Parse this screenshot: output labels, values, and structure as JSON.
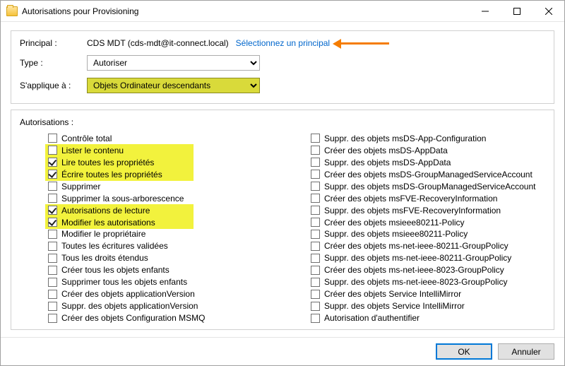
{
  "window": {
    "title": "Autorisations pour Provisioning"
  },
  "header": {
    "principal_label": "Principal :",
    "principal_value": "CDS MDT (cds-mdt@it-connect.local)",
    "select_principal_link": "Sélectionnez un principal",
    "type_label": "Type :",
    "type_value": "Autoriser",
    "applies_label": "S'applique à :",
    "applies_value": "Objets Ordinateur descendants"
  },
  "autz_label": "Autorisations :",
  "perms_left": [
    {
      "label": "Contrôle total",
      "checked": false,
      "hl": false
    },
    {
      "label": "Lister le contenu",
      "checked": false,
      "hl": true
    },
    {
      "label": "Lire toutes les propriétés",
      "checked": true,
      "hl": true
    },
    {
      "label": "Écrire toutes les propriétés",
      "checked": true,
      "hl": true
    },
    {
      "label": "Supprimer",
      "checked": false,
      "hl": false
    },
    {
      "label": "Supprimer la sous-arborescence",
      "checked": false,
      "hl": false
    },
    {
      "label": "Autorisations de lecture",
      "checked": true,
      "hl": true
    },
    {
      "label": "Modifier les autorisations",
      "checked": true,
      "hl": true
    },
    {
      "label": "Modifier le propriétaire",
      "checked": false,
      "hl": false
    },
    {
      "label": "Toutes les écritures validées",
      "checked": false,
      "hl": false
    },
    {
      "label": "Tous les droits étendus",
      "checked": false,
      "hl": false
    },
    {
      "label": "Créer tous les objets enfants",
      "checked": false,
      "hl": false
    },
    {
      "label": "Supprimer tous les objets enfants",
      "checked": false,
      "hl": false
    },
    {
      "label": "Créer des objets applicationVersion",
      "checked": false,
      "hl": false
    },
    {
      "label": "Suppr. des objets applicationVersion",
      "checked": false,
      "hl": false
    },
    {
      "label": "Créer des objets Configuration MSMQ",
      "checked": false,
      "hl": false
    }
  ],
  "perms_right": [
    {
      "label": "Suppr. des objets msDS-App-Configuration",
      "checked": false
    },
    {
      "label": "Créer des objets msDS-AppData",
      "checked": false
    },
    {
      "label": "Suppr. des objets msDS-AppData",
      "checked": false
    },
    {
      "label": "Créer des objets msDS-GroupManagedServiceAccount",
      "checked": false
    },
    {
      "label": "Suppr. des objets msDS-GroupManagedServiceAccount",
      "checked": false
    },
    {
      "label": "Créer des objets msFVE-RecoveryInformation",
      "checked": false
    },
    {
      "label": "Suppr. des objets msFVE-RecoveryInformation",
      "checked": false
    },
    {
      "label": "Créer des objets msieee80211-Policy",
      "checked": false
    },
    {
      "label": "Suppr. des objets msieee80211-Policy",
      "checked": false
    },
    {
      "label": "Créer des objets ms-net-ieee-80211-GroupPolicy",
      "checked": false
    },
    {
      "label": "Suppr. des objets ms-net-ieee-80211-GroupPolicy",
      "checked": false
    },
    {
      "label": "Créer des objets ms-net-ieee-8023-GroupPolicy",
      "checked": false
    },
    {
      "label": "Suppr. des objets ms-net-ieee-8023-GroupPolicy",
      "checked": false
    },
    {
      "label": "Créer des objets Service IntelliMirror",
      "checked": false
    },
    {
      "label": "Suppr. des objets Service IntelliMirror",
      "checked": false
    },
    {
      "label": "Autorisation d'authentifier",
      "checked": false
    }
  ],
  "footer": {
    "ok": "OK",
    "cancel": "Annuler"
  }
}
